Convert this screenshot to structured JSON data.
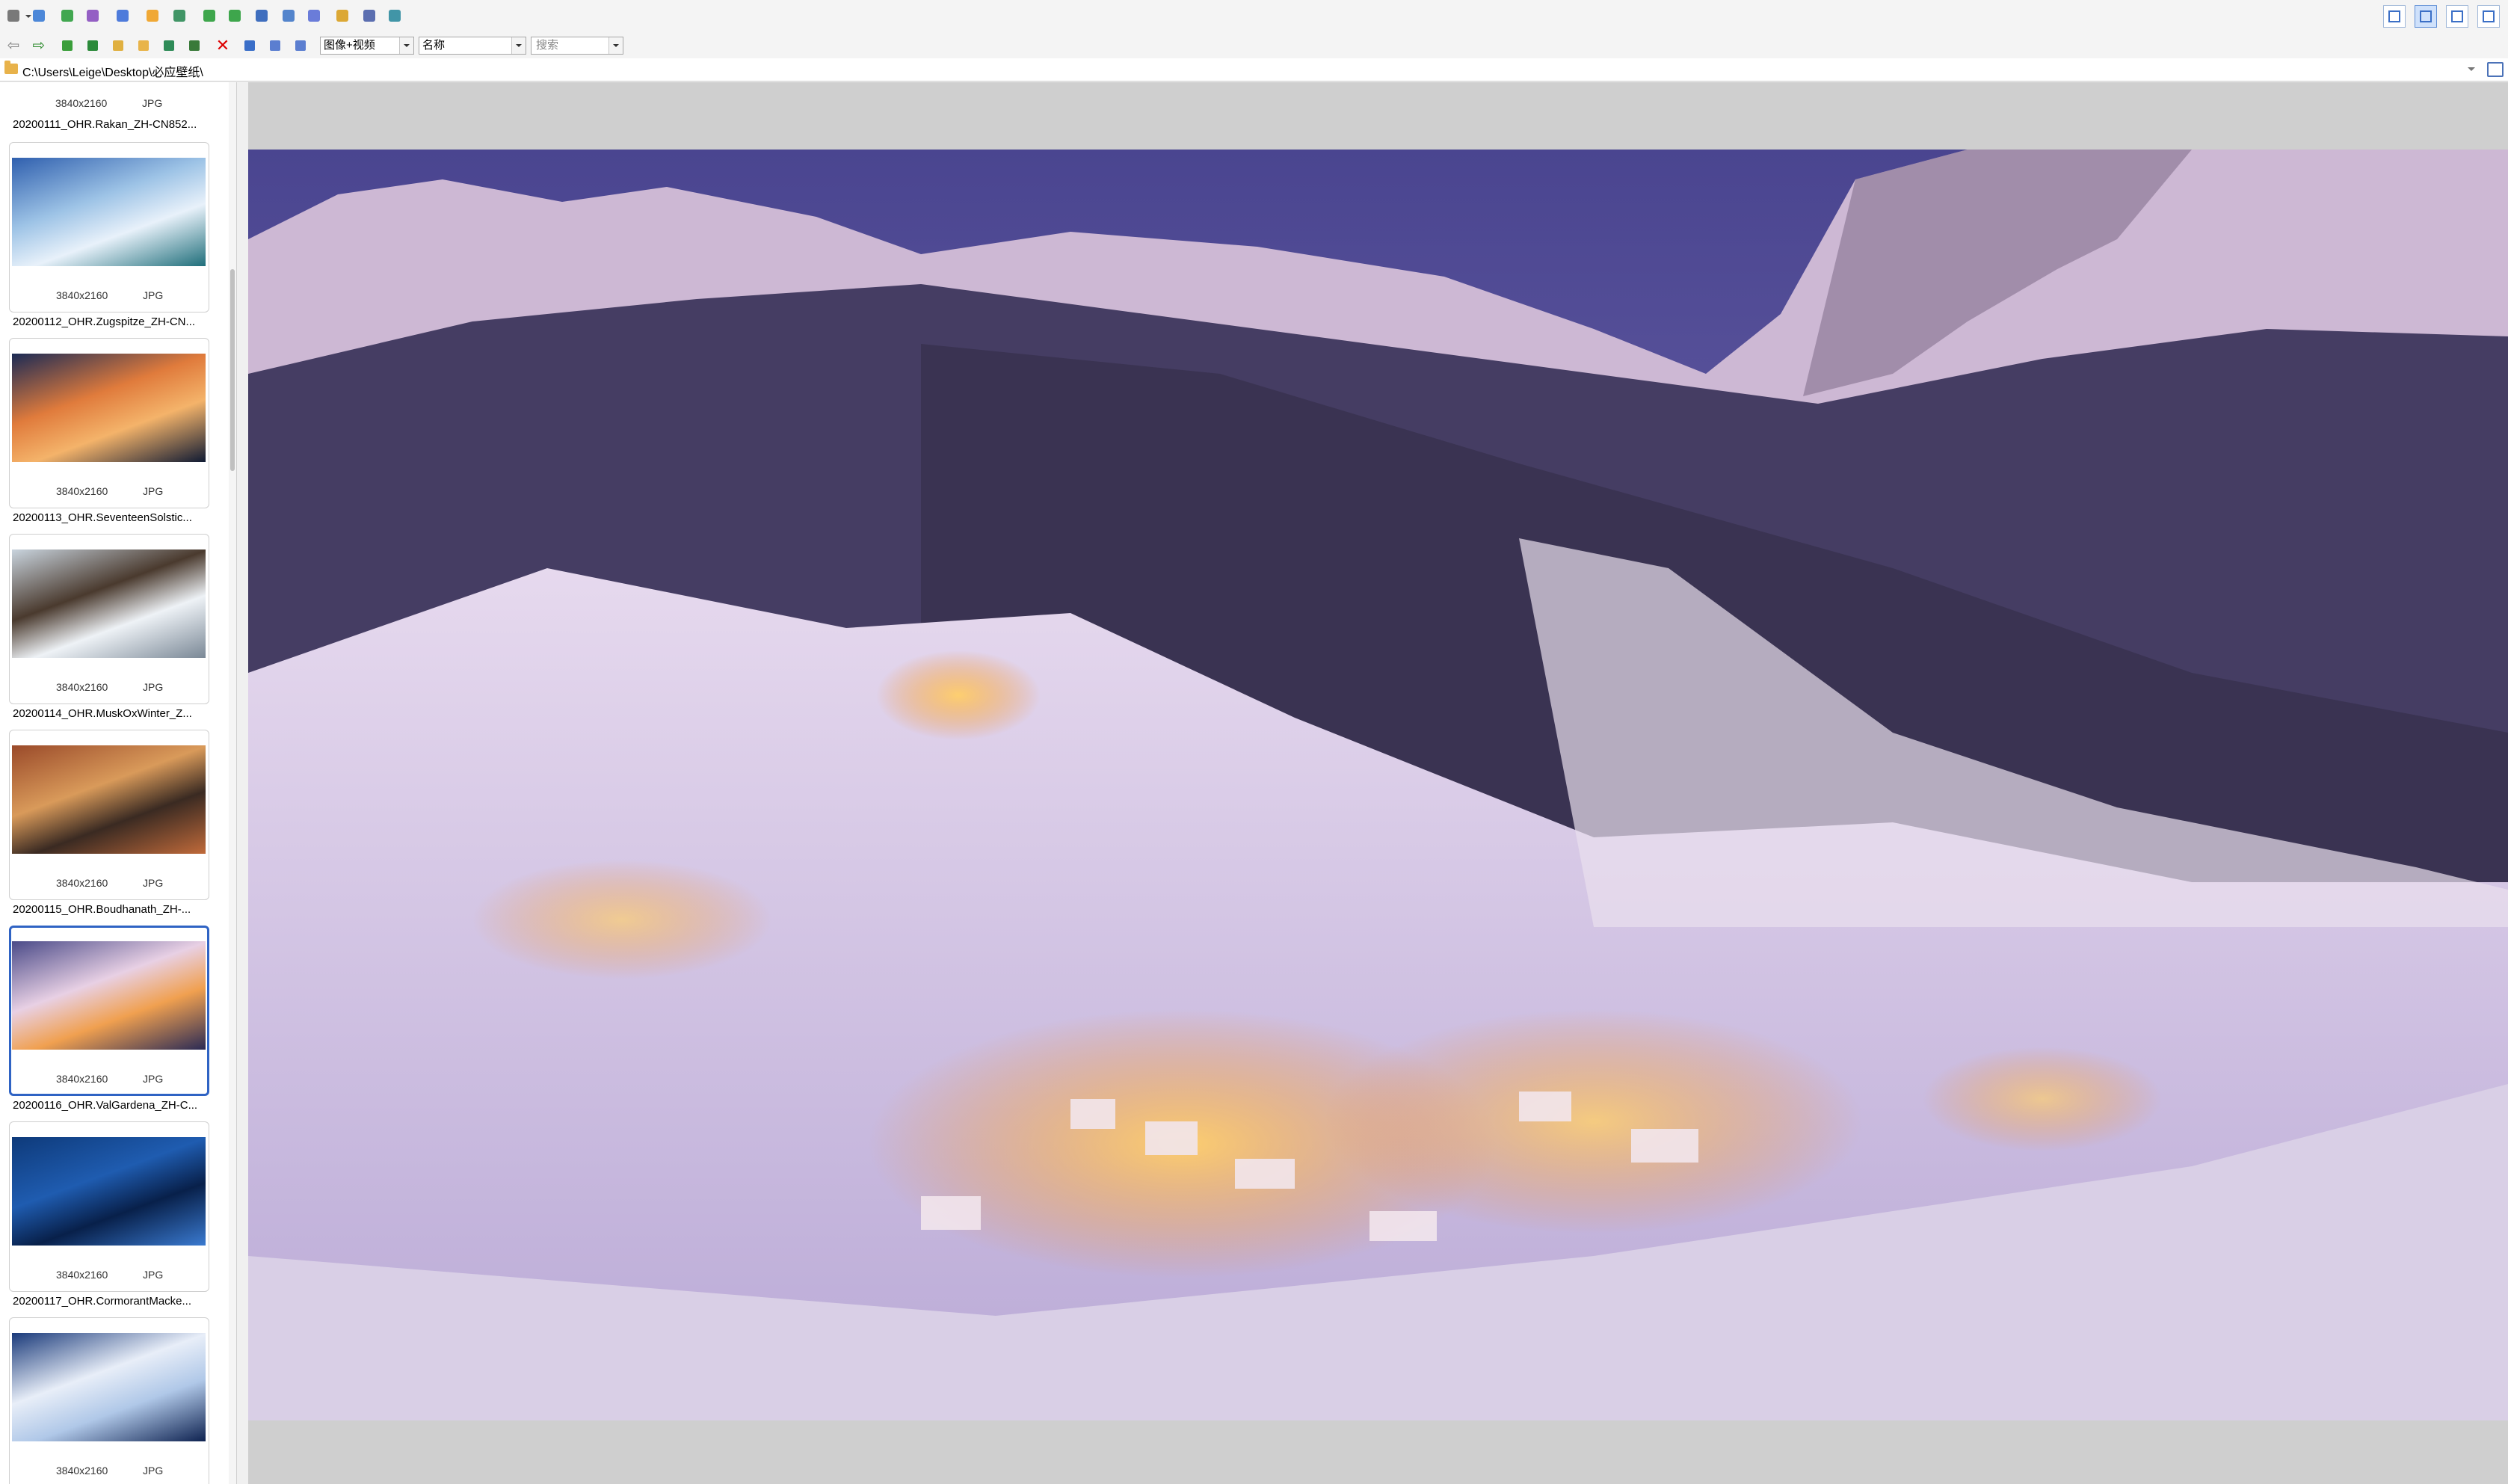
{
  "toolbar_top": {
    "buttons": [
      {
        "name": "hand-tool-icon",
        "color": "#6b6b6b"
      },
      {
        "name": "fullscreen-icon",
        "color": "#3a7bd5"
      },
      {
        "name": "slideshow-icon",
        "color": "#2e9e3e"
      },
      {
        "name": "image-edit-icon",
        "color": "#8a4fbf"
      },
      {
        "name": "batch-icon",
        "color": "#3c6ed8"
      },
      {
        "name": "settings-icon",
        "color": "#f0a020"
      },
      {
        "name": "user-icon",
        "color": "#2e8b57"
      },
      {
        "name": "rotate-left-icon",
        "color": "#2a9d3a"
      },
      {
        "name": "rotate-right-icon",
        "color": "#2a9d3a"
      },
      {
        "name": "crop-icon",
        "color": "#2b5fb8"
      },
      {
        "name": "screen-capture-icon",
        "color": "#4178c8"
      },
      {
        "name": "scan-icon",
        "color": "#5b6fd6"
      },
      {
        "name": "convert-icon",
        "color": "#d9a020"
      },
      {
        "name": "print-icon",
        "color": "#4a5fa8"
      },
      {
        "name": "export-icon",
        "color": "#2e8b9e"
      }
    ],
    "view_modes": [
      "thumbnail-view-icon",
      "filmstrip-view-icon",
      "preview-view-icon",
      "fit-view-icon"
    ]
  },
  "toolbar_second": {
    "filter_select": "图像+视频",
    "sort_select": "名称",
    "search_placeholder": "搜索"
  },
  "address": {
    "path": "C:\\Users\\Leige\\Desktop\\必应壁纸\\"
  },
  "thumbnails": {
    "partial_top": {
      "dims": "3840x2160",
      "type": "JPG",
      "name": "20200111_OHR.Rakan_ZH-CN852..."
    },
    "items": [
      {
        "dims": "3840x2160",
        "type": "JPG",
        "name": "20200112_OHR.Zugspitze_ZH-CN...",
        "selected": false,
        "palette": [
          "#2f5fae",
          "#9dc3e6",
          "#e8f1fa",
          "#1f6e7a"
        ]
      },
      {
        "dims": "3840x2160",
        "type": "JPG",
        "name": "20200113_OHR.SeventeenSolstic...",
        "selected": false,
        "palette": [
          "#1b2a55",
          "#e07b3c",
          "#f4b36a",
          "#0f1a33"
        ]
      },
      {
        "dims": "3840x2160",
        "type": "JPG",
        "name": "20200114_OHR.MuskOxWinter_Z...",
        "selected": false,
        "palette": [
          "#c9d4de",
          "#4a3a2e",
          "#eef2f6",
          "#7a8896"
        ]
      },
      {
        "dims": "3840x2160",
        "type": "JPG",
        "name": "20200115_OHR.Boudhanath_ZH-...",
        "selected": false,
        "palette": [
          "#9a4a2a",
          "#d99a5a",
          "#3a2a22",
          "#c06a3a"
        ]
      },
      {
        "dims": "3840x2160",
        "type": "JPG",
        "name": "20200116_OHR.ValGardena_ZH-C...",
        "selected": true,
        "palette": [
          "#4a4a88",
          "#e8d0e4",
          "#f0a050",
          "#2a2a55"
        ]
      },
      {
        "dims": "3840x2160",
        "type": "JPG",
        "name": "20200117_OHR.CormorantMacke...",
        "selected": false,
        "palette": [
          "#0e3a7a",
          "#1f5cb0",
          "#08204a",
          "#3a7ad0"
        ]
      },
      {
        "dims": "3840x2160",
        "type": "JPG",
        "name": "",
        "selected": false,
        "palette": [
          "#1a3a7a",
          "#e8eef8",
          "#b0c8e8",
          "#0e2250"
        ]
      }
    ]
  },
  "viewer": {
    "colors": {
      "sky": "#5f5a9e",
      "mountain": "#c9b6cf",
      "forest": "#3a3455",
      "snow": "#e9dfee",
      "lights": "#f4a33a"
    }
  }
}
